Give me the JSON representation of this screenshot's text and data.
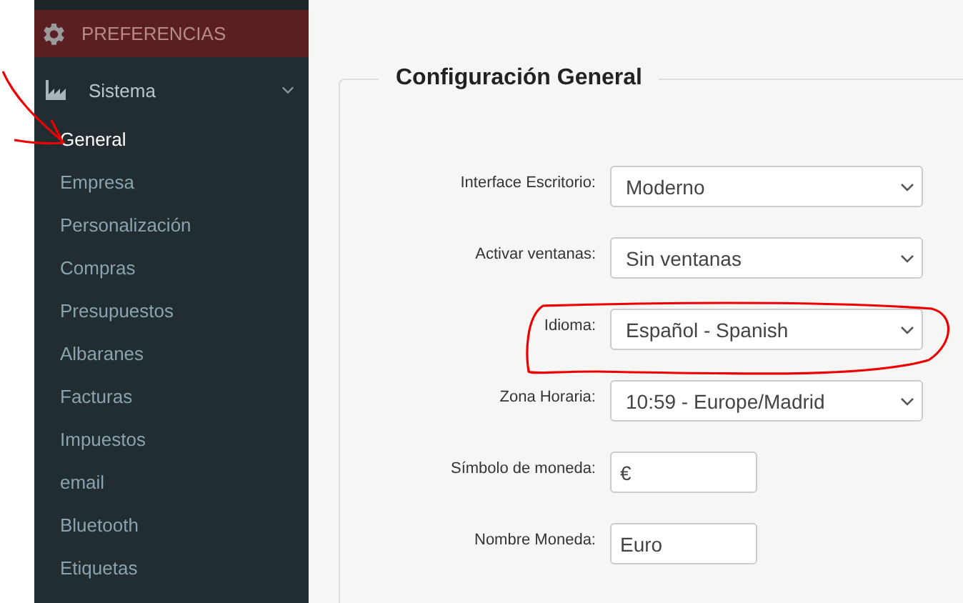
{
  "sidebar": {
    "header": "PREFERENCIAS",
    "group": {
      "label": "Sistema",
      "expanded": true
    },
    "items": [
      {
        "label": "General",
        "selected": true
      },
      {
        "label": "Empresa",
        "selected": false
      },
      {
        "label": "Personalización",
        "selected": false
      },
      {
        "label": "Compras",
        "selected": false
      },
      {
        "label": "Presupuestos",
        "selected": false
      },
      {
        "label": "Albaranes",
        "selected": false
      },
      {
        "label": "Facturas",
        "selected": false
      },
      {
        "label": "Impuestos",
        "selected": false
      },
      {
        "label": "email",
        "selected": false
      },
      {
        "label": "Bluetooth",
        "selected": false
      },
      {
        "label": "Etiquetas",
        "selected": false
      }
    ]
  },
  "form": {
    "title": "Configuración General",
    "fields": [
      {
        "label": "Interface Escritorio:",
        "kind": "select",
        "value": "Moderno"
      },
      {
        "label": "Activar ventanas:",
        "kind": "select",
        "value": "Sin ventanas"
      },
      {
        "label": "Idioma:",
        "kind": "select",
        "value": "Español - Spanish"
      },
      {
        "label": "Zona Horaria:",
        "kind": "select",
        "value": "10:59 - Europe/Madrid"
      },
      {
        "label": "Símbolo de moneda:",
        "kind": "input",
        "value": "€"
      },
      {
        "label": "Nombre Moneda:",
        "kind": "input",
        "value": "Euro"
      }
    ]
  }
}
